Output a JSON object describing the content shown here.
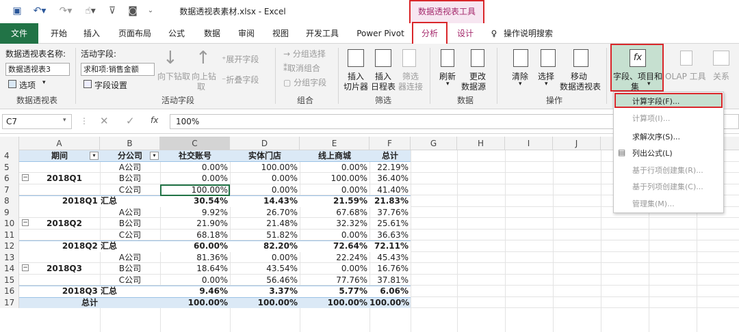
{
  "window": {
    "title": "数据透视表素材.xlsx - Excel",
    "contextual_group": "数据透视表工具"
  },
  "tabs": [
    "文件",
    "开始",
    "插入",
    "页面布局",
    "公式",
    "数据",
    "审阅",
    "视图",
    "开发工具",
    "Power Pivot",
    "分析",
    "设计"
  ],
  "tell_me": "操作说明搜索",
  "ribbon": {
    "pivot_name_label": "数据透视表名称:",
    "pivot_name_value": "数据透视表3",
    "options": "选项",
    "group_pivot": "数据透视表",
    "active_field_label": "活动字段:",
    "active_field_value": "求和项:销售金额",
    "field_settings": "字段设置",
    "drill_down": [
      "向下钻取"
    ],
    "drill_up": [
      "向上钻",
      "取"
    ],
    "expand_field": "展开字段",
    "collapse_field": "折叠字段",
    "group_active": "活动字段",
    "group_selection": "分组选择",
    "ungroup": "取消组合",
    "group_field": "分组字段",
    "group_group": "组合",
    "insert_slicer": [
      "插入",
      "切片器"
    ],
    "insert_timeline": [
      "插入",
      "日程表"
    ],
    "filter_connections": [
      "筛选",
      "器连接"
    ],
    "group_filter": "筛选",
    "refresh": "刷新",
    "change_source": [
      "更改",
      "数据源"
    ],
    "group_data": "数据",
    "clear": "清除",
    "select": "选择",
    "move_pivot": [
      "移动",
      "数据透视表"
    ],
    "group_actions": "操作",
    "fields_items_sets": [
      "字段、项目和",
      "集"
    ],
    "olap_tools": "OLAP 工具",
    "relationships": "关系"
  },
  "formula_bar": {
    "name_box": "C7",
    "fx": "fx",
    "value": "100%"
  },
  "columns": [
    "A",
    "B",
    "C",
    "D",
    "E",
    "F",
    "G",
    "H",
    "I",
    "J"
  ],
  "rows": [
    "4",
    "5",
    "6",
    "7",
    "8",
    "9",
    "10",
    "11",
    "12",
    "13",
    "14",
    "15",
    "16",
    "17"
  ],
  "table": {
    "headers": [
      "期间",
      "分公司",
      "社交账号",
      "实体门店",
      "线上商城",
      "总计"
    ],
    "body": [
      {
        "period": "",
        "branch": "A公司",
        "vals": [
          "0.00%",
          "100.00%",
          "0.00%",
          "22.19%"
        ]
      },
      {
        "period": "2018Q1",
        "branch": "B公司",
        "vals": [
          "0.00%",
          "0.00%",
          "100.00%",
          "36.40%"
        ]
      },
      {
        "period": "",
        "branch": "C公司",
        "vals": [
          "100.00%",
          "0.00%",
          "0.00%",
          "41.40%"
        ]
      },
      {
        "subtotal": "2018Q1 汇总",
        "vals": [
          "30.54%",
          "14.43%",
          "21.59%",
          "21.83%"
        ]
      },
      {
        "period": "",
        "branch": "A公司",
        "vals": [
          "9.92%",
          "26.70%",
          "67.68%",
          "37.76%"
        ]
      },
      {
        "period": "2018Q2",
        "branch": "B公司",
        "vals": [
          "21.90%",
          "21.48%",
          "32.32%",
          "25.61%"
        ]
      },
      {
        "period": "",
        "branch": "C公司",
        "vals": [
          "68.18%",
          "51.82%",
          "0.00%",
          "36.63%"
        ]
      },
      {
        "subtotal": "2018Q2 汇总",
        "vals": [
          "60.00%",
          "82.20%",
          "72.64%",
          "72.11%"
        ]
      },
      {
        "period": "",
        "branch": "A公司",
        "vals": [
          "81.36%",
          "0.00%",
          "22.24%",
          "45.43%"
        ]
      },
      {
        "period": "2018Q3",
        "branch": "B公司",
        "vals": [
          "18.64%",
          "43.54%",
          "0.00%",
          "16.76%"
        ]
      },
      {
        "period": "",
        "branch": "C公司",
        "vals": [
          "0.00%",
          "56.46%",
          "77.76%",
          "37.81%"
        ]
      },
      {
        "subtotal": "2018Q3 汇总",
        "vals": [
          "9.46%",
          "3.37%",
          "5.77%",
          "6.06%"
        ]
      },
      {
        "total": "总计",
        "vals": [
          "100.00%",
          "100.00%",
          "100.00%",
          "100.00%"
        ]
      }
    ]
  },
  "menu": {
    "items": [
      "计算字段(F)...",
      "计算项(I)...",
      "求解次序(S)...",
      "列出公式(L)",
      "基于行项创建集(R)...",
      "基于列项创建集(C)...",
      "管理集(M)..."
    ]
  },
  "colors": {
    "excel_green": "#217346",
    "highlight": "#d9262a",
    "context_pink": "#a4286b",
    "header_fill": "#dbe9f6"
  }
}
